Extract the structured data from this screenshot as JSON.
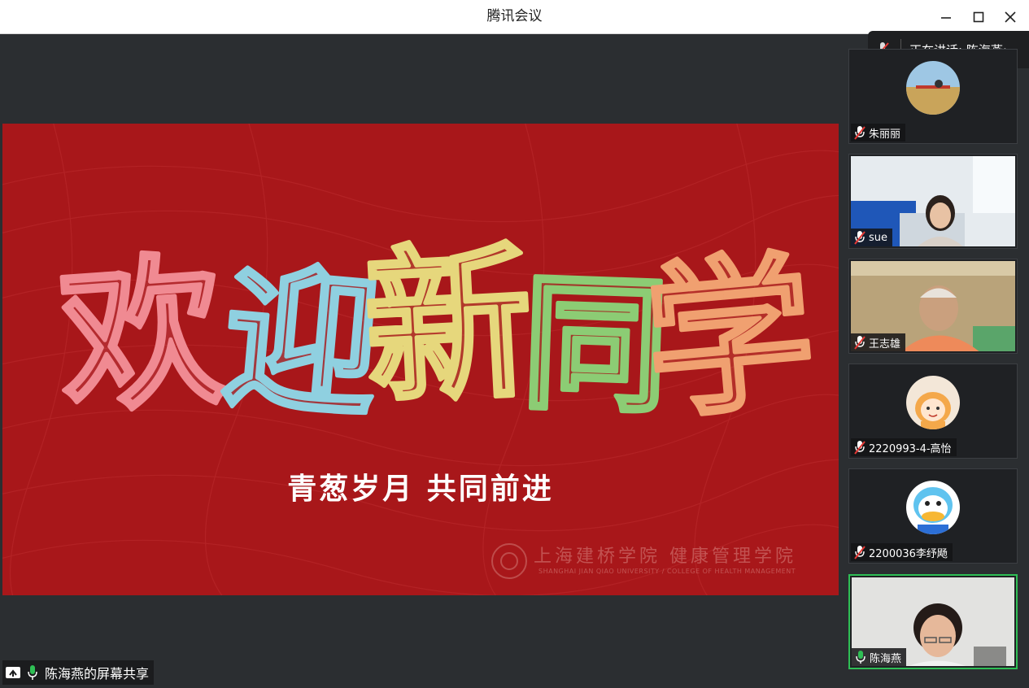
{
  "window": {
    "title": "腾讯会议"
  },
  "slide": {
    "headline_chars": [
      "欢",
      "迎",
      "新",
      "同",
      "学"
    ],
    "subtitle": "青葱岁月  共同前进",
    "logo_cn": "上海建桥学院  健康管理学院",
    "logo_en": "SHANGHAI JIAN QIAO UNIVERSITY  /  COLLEGE OF HEALTH MANAGEMENT"
  },
  "share_label": "陈海燕的屏幕共享",
  "speaker": {
    "text": "正在讲话: 陈海燕;"
  },
  "participants": [
    {
      "name": "朱丽丽",
      "mic": "muted"
    },
    {
      "name": "sue",
      "mic": "muted"
    },
    {
      "name": "王志雄",
      "mic": "muted"
    },
    {
      "name": "2220993-4-高怡",
      "mic": "muted"
    },
    {
      "name": "2200036李纾飏",
      "mic": "muted"
    },
    {
      "name": "陈海燕",
      "mic": "on"
    }
  ],
  "colors": {
    "slide_red": "#a8171a",
    "headline": [
      "#f08a92",
      "#8fd0e0",
      "#e6d77c",
      "#8ccc74",
      "#f0a070"
    ],
    "active_green": "#2fbf55",
    "muted_red": "#e53935"
  }
}
